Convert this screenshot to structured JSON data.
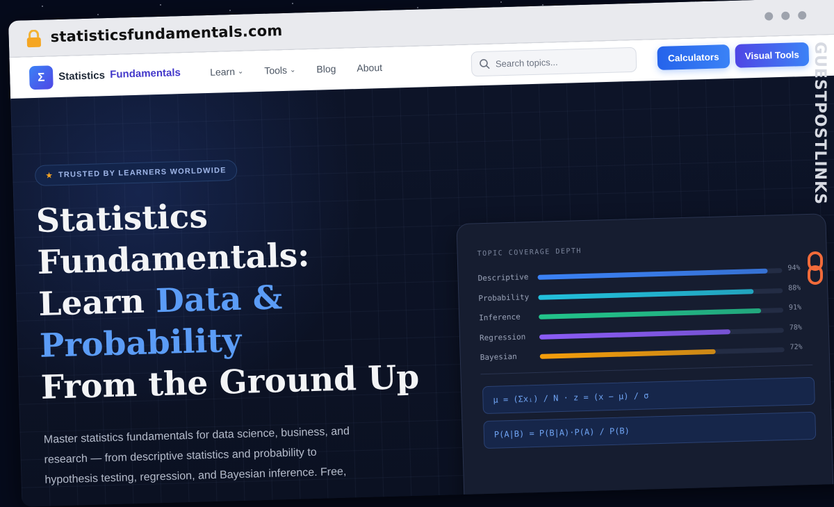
{
  "browser": {
    "url": "statisticsfundamentals.com"
  },
  "nav": {
    "brand_primary": "Statistics",
    "brand_accent": "Fundamentals",
    "logo_symbol": "Σ",
    "links": [
      {
        "label": "Learn",
        "dropdown": true
      },
      {
        "label": "Tools",
        "dropdown": true
      },
      {
        "label": "Blog",
        "dropdown": false
      },
      {
        "label": "About",
        "dropdown": false
      }
    ],
    "search_placeholder": "Search topics...",
    "cta_primary": "Calculators",
    "cta_secondary": "Visual Tools"
  },
  "hero": {
    "badge": "TRUSTED BY LEARNERS WORLDWIDE",
    "title_line1": "Statistics",
    "title_line2": "Fundamentals:",
    "title_line3_plain": "Learn ",
    "title_line3_accent": "Data &",
    "title_line4_accent": "Probability",
    "title_line5": "From the Ground Up",
    "subtitle": "Master statistics fundamentals for data science, business, and research — from descriptive statistics and probability to hypothesis testing, regression, and Bayesian inference. Free,"
  },
  "coverage_card": {
    "title": "TOPIC COVERAGE DEPTH",
    "bars": [
      {
        "label": "Descriptive",
        "value": 94,
        "value_text": "94%",
        "color": "#3b82f6"
      },
      {
        "label": "Probability",
        "value": 88,
        "value_text": "88%",
        "color": "#22c1dc"
      },
      {
        "label": "Inference",
        "value": 91,
        "value_text": "91%",
        "color": "#22c58b"
      },
      {
        "label": "Regression",
        "value": 78,
        "value_text": "78%",
        "color": "#8b5cf6"
      },
      {
        "label": "Bayesian",
        "value": 72,
        "value_text": "72%",
        "color": "#f59e0b"
      }
    ],
    "formulas": [
      "μ = (Σxᵢ) / N  ·  z = (x − μ) / σ",
      "P(A|B) = P(B|A)·P(A) / P(B)"
    ]
  },
  "watermark": {
    "text": "GUESTPOSTLINKS"
  },
  "colors": {
    "accent_blue": "#5b9cf6",
    "brand_indigo": "#4338ca",
    "watermark_orange": "#f26b3a"
  }
}
